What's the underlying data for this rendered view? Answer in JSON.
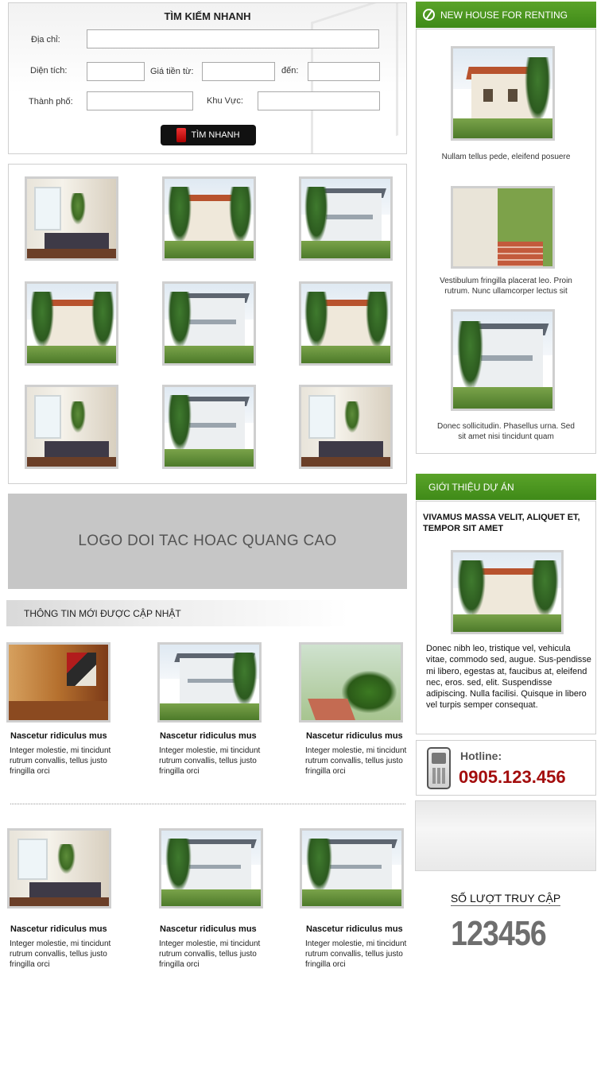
{
  "search": {
    "title": "TÌM KIẾM NHANH",
    "address_label": "Địa chỉ:",
    "area_label": "Diện tích:",
    "price_from_label": "Giá tiền từ:",
    "price_to_label": "đến:",
    "city_label": "Thành phố:",
    "region_label": "Khu Vực:",
    "button_label": "TÌM NHANH",
    "address_value": "",
    "area_value": "",
    "price_from_value": "",
    "price_to_value": "",
    "city_value": "",
    "region_value": ""
  },
  "ad_banner": {
    "text": "LOGO DOI TAC HOAC QUANG CAO"
  },
  "news": {
    "header": "THÔNG TIN MỚI ĐƯỢC CẬP NHẬT",
    "items": [
      {
        "title": "Nascetur ridiculus mus",
        "desc": "Integer molestie, mi tincidunt rutrum convallis, tellus justo fringilla orci"
      },
      {
        "title": "Nascetur ridiculus mus",
        "desc": "Integer molestie, mi tincidunt rutrum convallis, tellus justo fringilla orci"
      },
      {
        "title": "Nascetur ridiculus mus",
        "desc": "Integer molestie, mi tincidunt rutrum convallis, tellus justo fringilla orci"
      },
      {
        "title": "Nascetur ridiculus mus",
        "desc": "Integer molestie, mi tincidunt rutrum convallis, tellus justo fringilla orci"
      },
      {
        "title": "Nascetur ridiculus mus",
        "desc": "Integer molestie, mi tincidunt rutrum convallis, tellus justo fringilla orci"
      },
      {
        "title": "Nascetur ridiculus mus",
        "desc": "Integer molestie, mi tincidunt rutrum convallis, tellus justo fringilla orci"
      }
    ]
  },
  "renting": {
    "header": "NEW HOUSE FOR RENTING",
    "items": [
      {
        "caption": "Nullam tellus pede, eleifend posuere"
      },
      {
        "caption": "Vestibulum fringilla placerat leo. Proin rutrum. Nunc ullamcorper lectus sit"
      },
      {
        "caption": "Donec sollicitudin. Phasellus urna. Sed sit amet nisi tincidunt quam"
      }
    ]
  },
  "intro": {
    "header": "GIỚI THIỆU DỰ ÁN",
    "heading": "VIVAMUS MASSA VELIT, ALIQUET ET, TEMPOR SIT AMET",
    "body": "Donec nibh leo, tristique vel, vehicula vitae, commodo sed, augue. Sus-pendisse mi libero, egestas at, faucibus at, eleifend nec, eros. sed, elit. Suspendisse adipiscing. Nulla facilisi. Quisque in libero vel turpis semper consequat."
  },
  "hotline": {
    "label": "Hotline:",
    "number": "0905.123.456"
  },
  "visits": {
    "label": "SỐ LƯỢT TRUY CẬP",
    "count": "123456"
  },
  "colors": {
    "accent_green": "#4a951f",
    "hotline_red": "#a30d0d"
  },
  "icons": [
    "globe-icon",
    "search-button-icon",
    "phone-icon"
  ]
}
